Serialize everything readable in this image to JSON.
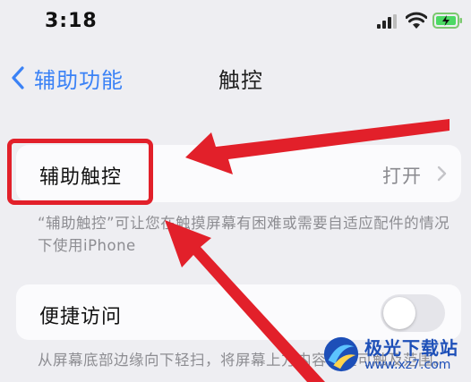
{
  "status_bar": {
    "time": "3:18"
  },
  "nav": {
    "back_label": "辅助功能",
    "title": "触控"
  },
  "assistive_touch": {
    "label": "辅助触控",
    "value": "打开"
  },
  "assistive_touch_footnote": "“辅助触控”可让您在触摸屏幕有困难或需要自适应配件的情况下使用iPhone",
  "reachability": {
    "label": "便捷访问",
    "enabled": false
  },
  "reachability_footnote": "从屏幕底部边缘向下轻扫，将屏幕上方内容移至可触及范围。",
  "watermark": {
    "name": "极光下载站",
    "url": "www.xz7.com"
  },
  "colors": {
    "accent": "#3b82f6",
    "annotation": "#e2202a",
    "background": "#eeeef2",
    "toggle_off": "#e5e5ea"
  },
  "icons": [
    "signal-icon",
    "wifi-icon",
    "battery-icon",
    "chevron-left-icon",
    "chevron-right-icon",
    "arrow-annotation"
  ]
}
